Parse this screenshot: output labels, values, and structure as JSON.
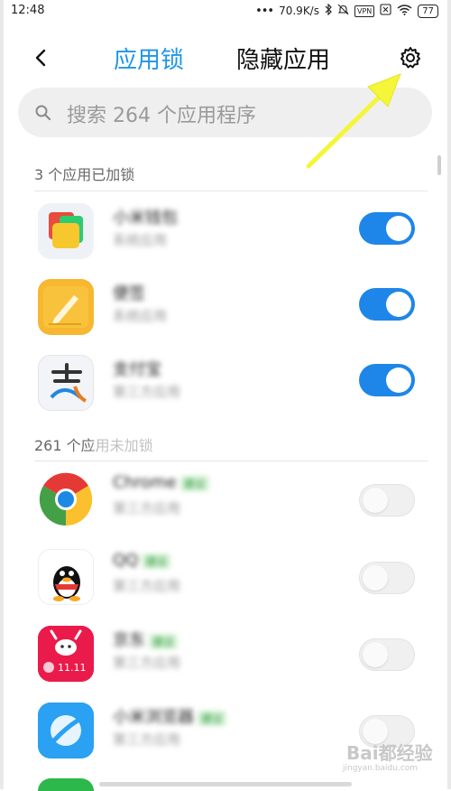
{
  "status_bar": {
    "time": "12:48",
    "dots": "•••",
    "net_speed": "70.9K/s",
    "vpn": "VPN",
    "battery": "77"
  },
  "header": {
    "tab_applock": "应用锁",
    "tab_hidden": "隐藏应用"
  },
  "search": {
    "placeholder": "搜索 264 个应用程序"
  },
  "locked_section": {
    "title": "3 个应用已加锁",
    "apps": [
      {
        "name": "小米钱包",
        "tag": "",
        "sub": "系统应用",
        "locked": true,
        "icon": "mi-wallet-icon"
      },
      {
        "name": "便签",
        "tag": "",
        "sub": "系统应用",
        "locked": true,
        "icon": "notes-icon"
      },
      {
        "name": "支付宝",
        "tag": "",
        "sub": "第三方应用",
        "locked": true,
        "icon": "alipay-icon"
      }
    ]
  },
  "unlocked_section": {
    "title": "261 个应用未加锁",
    "apps": [
      {
        "name": "Chrome",
        "tag": "建议",
        "sub": "第三方应用",
        "locked": false,
        "icon": "chrome-icon"
      },
      {
        "name": "QQ",
        "tag": "建议",
        "sub": "第三方应用",
        "locked": false,
        "icon": "qq-icon"
      },
      {
        "name": "京东",
        "tag": "建议",
        "sub": "第三方应用",
        "locked": false,
        "icon": "jd-icon"
      },
      {
        "name": "小米浏览器",
        "tag": "建议",
        "sub": "第三方应用",
        "locked": false,
        "icon": "mi-browser-icon"
      }
    ]
  },
  "watermark": {
    "text": "Bai都经验",
    "sub": "jingyan.baidu.com"
  },
  "colors": {
    "accent": "#1e96e8",
    "toggle_on": "#1e86e8",
    "arrow": "#f5f53a"
  }
}
